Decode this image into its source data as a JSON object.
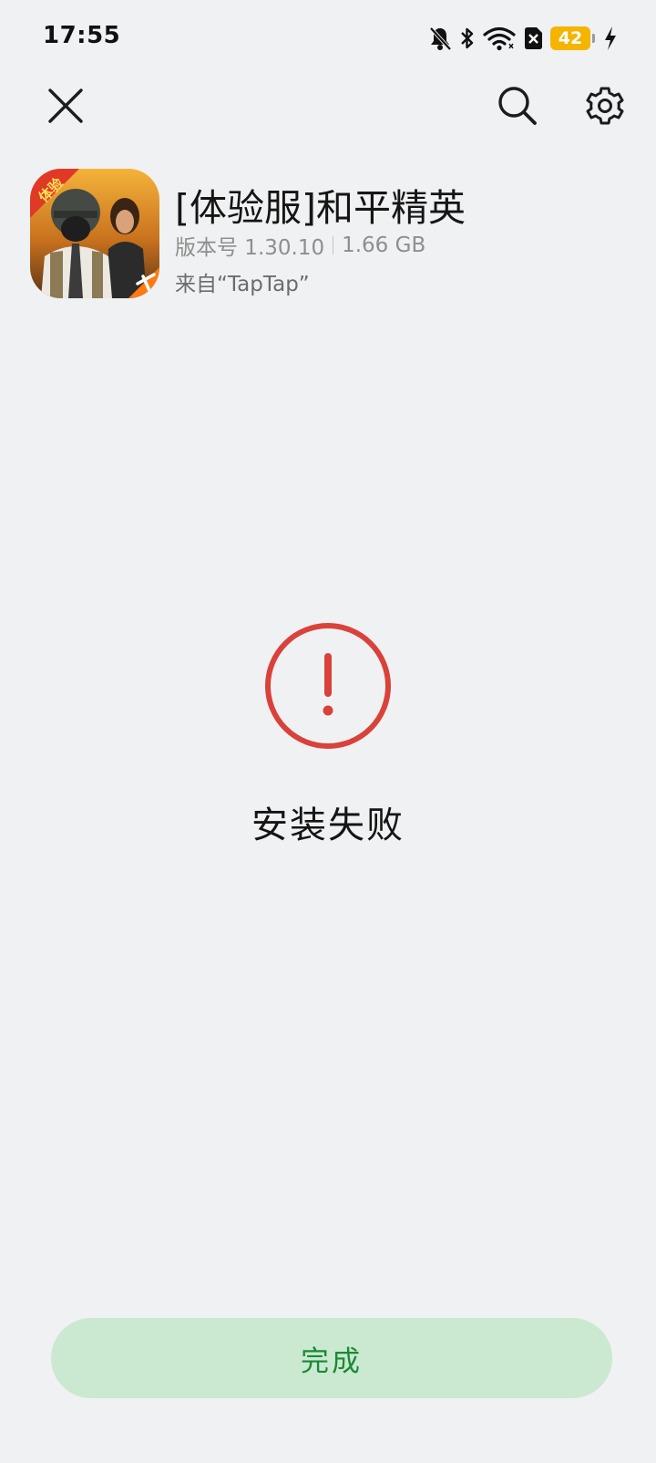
{
  "status_bar": {
    "time": "17:55",
    "battery_level": "42",
    "icons": [
      "bell-off-icon",
      "bluetooth-icon",
      "wifi-icon",
      "sim-off-icon",
      "battery-icon",
      "charging-bolt-icon"
    ]
  },
  "top_bar": {
    "icons": [
      "close-icon",
      "search-icon",
      "gear-icon"
    ]
  },
  "app": {
    "title": "[体验服]和平精英",
    "version": "版本号 1.30.10",
    "size": "1.66 GB",
    "source": "来自“TapTap”",
    "icon_badge": "体验"
  },
  "install": {
    "status": "安装失败",
    "icon": "error-circle-icon",
    "status_color": "#d9423a"
  },
  "actions": {
    "done_label": "完成",
    "done_bg": "#cbe8d1",
    "done_text_color": "#1a8a35"
  }
}
